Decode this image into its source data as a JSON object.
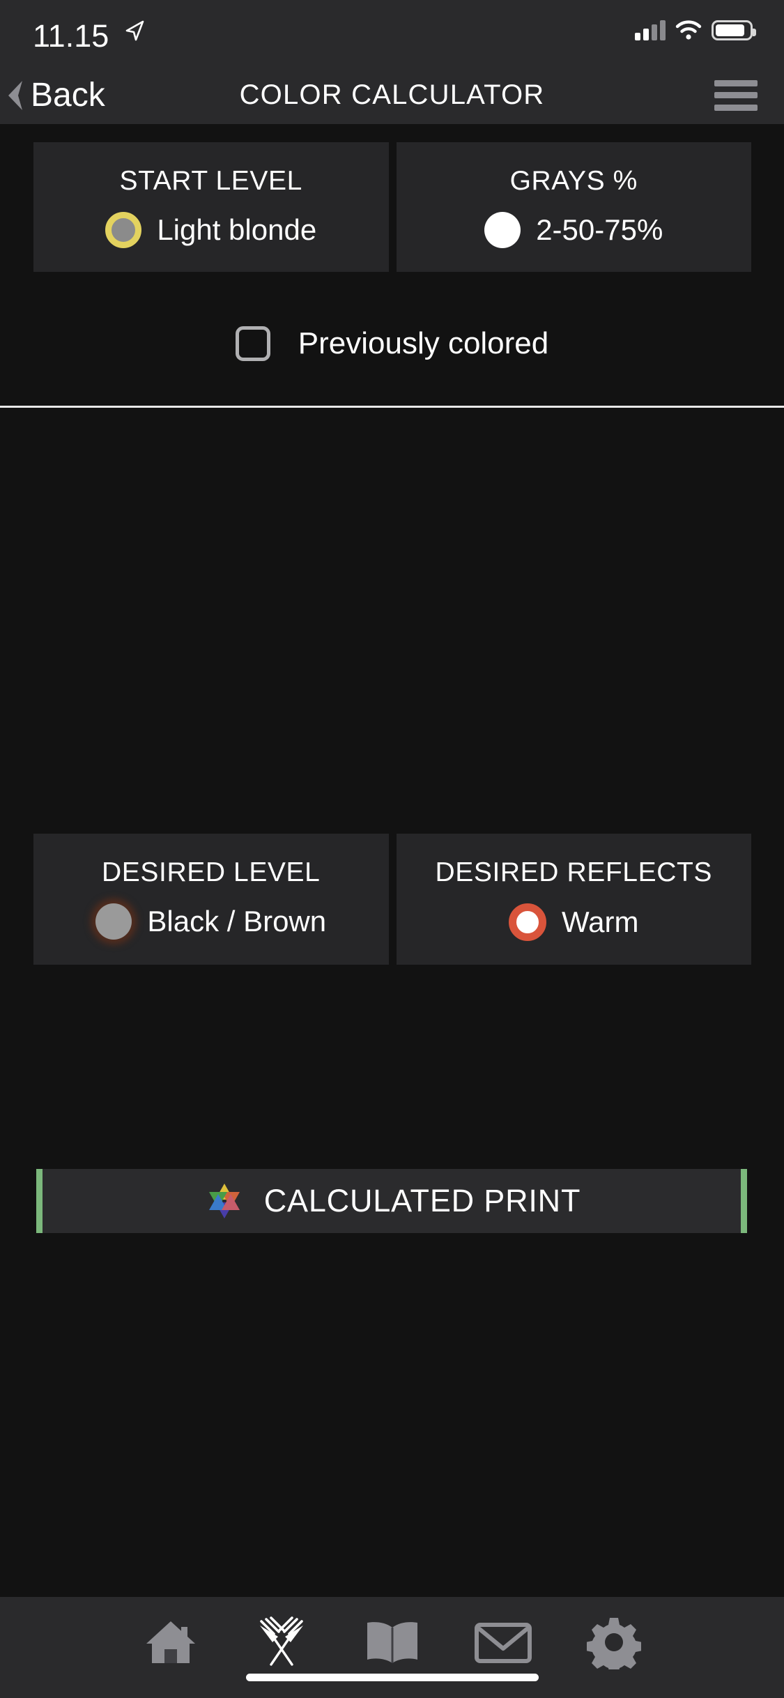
{
  "status_bar": {
    "time": "11.15",
    "location_icon": "location-arrow-icon",
    "signal_icon": "cellular-signal-icon",
    "wifi_icon": "wifi-icon",
    "battery_icon": "battery-icon"
  },
  "nav": {
    "back_label": "Back",
    "back_icon": "chevron-left-icon",
    "title": "COLOR CALCULATOR",
    "menu_icon": "hamburger-menu-icon"
  },
  "start_section": {
    "cards": [
      {
        "title": "START LEVEL",
        "value": "Light blonde",
        "swatch_name": "light-blonde-swatch",
        "swatch_color": "#8b8b8b",
        "swatch_ring_color": "#e3d25f"
      },
      {
        "title": "GRAYS %",
        "value": "2-50-75%",
        "swatch_name": "grays-percent-swatch",
        "swatch_color": "#ffffff",
        "swatch_ring_color": "#ffffff"
      }
    ],
    "checkbox": {
      "label": "Previously colored",
      "checked": false
    }
  },
  "desired_section": {
    "cards": [
      {
        "title": "DESIRED LEVEL",
        "value": "Black / Brown",
        "swatch_name": "black-brown-swatch",
        "swatch_color": "#9a9a9a",
        "swatch_ring_color": "#5a2e1c"
      },
      {
        "title": "DESIRED REFLECTS",
        "value": "Warm",
        "swatch_name": "warm-swatch",
        "swatch_color": "#ffffff",
        "swatch_ring_color": "#d9543b"
      }
    ]
  },
  "calculate": {
    "label": "CALCULATED PRINT",
    "icon": "color-star-icon",
    "accent_color": "#7cb87c"
  },
  "tabbar": {
    "items": [
      {
        "name": "home-icon",
        "label": "Home",
        "active": false
      },
      {
        "name": "crossed-brushes-icon",
        "label": "Tools",
        "active": true
      },
      {
        "name": "book-icon",
        "label": "Guide",
        "active": false
      },
      {
        "name": "mail-icon",
        "label": "Mail",
        "active": false
      },
      {
        "name": "gear-icon",
        "label": "Settings",
        "active": false
      }
    ]
  },
  "colors": {
    "background": "#121212",
    "bar_background": "#2a2a2c",
    "card_background": "#262628",
    "accent_green": "#7cb87c",
    "accent_orange": "#d9543b",
    "accent_yellow": "#e3d25f",
    "icon_inactive": "#8e8e93",
    "icon_active": "#ffffff"
  }
}
